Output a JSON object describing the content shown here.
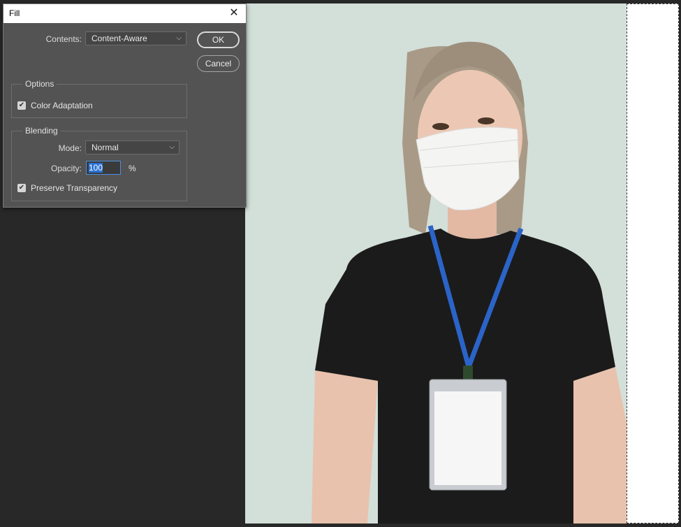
{
  "dialog": {
    "title": "Fill",
    "contents_label": "Contents:",
    "contents_value": "Content-Aware",
    "ok_label": "OK",
    "cancel_label": "Cancel",
    "options": {
      "legend": "Options",
      "color_adaptation_label": "Color Adaptation",
      "color_adaptation_checked": true
    },
    "blending": {
      "legend": "Blending",
      "mode_label": "Mode:",
      "mode_value": "Normal",
      "opacity_label": "Opacity:",
      "opacity_value": "100",
      "opacity_unit": "%",
      "preserve_label": "Preserve Transparency",
      "preserve_checked": true
    }
  },
  "icons": {
    "close": "close-icon",
    "chevron": "chevron-down-icon",
    "check": "checkmark-icon"
  },
  "colors": {
    "workspace": "#282828",
    "dialog_bg": "#535353",
    "photo_bg": "#d3dfd9",
    "selection_fill": "#ffffff"
  }
}
